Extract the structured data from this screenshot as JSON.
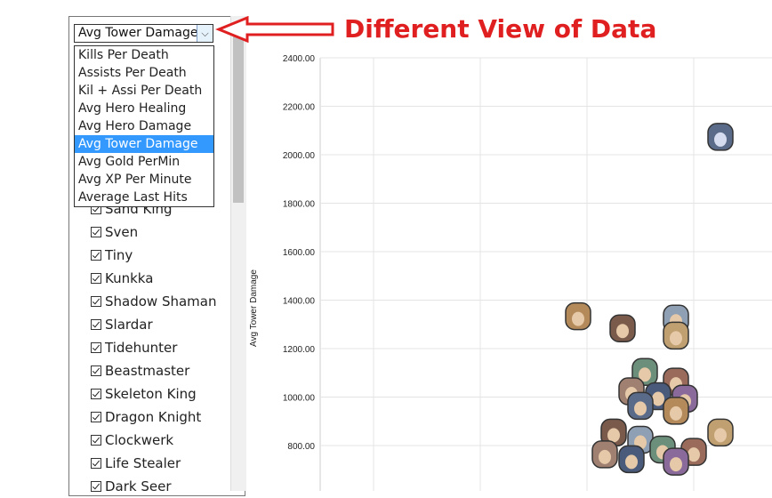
{
  "dropdown": {
    "selected": "Avg Tower Damage",
    "options": [
      "Kills Per Death",
      "Assists Per Death",
      "Kil + Assi Per Death",
      "Avg Hero Healing",
      "Avg Hero Damage",
      "Avg Tower Damage",
      "Avg Gold PerMin",
      "Avg XP Per Minute",
      "Average Last Hits"
    ],
    "selected_index": 5
  },
  "heroes": [
    "Sand King",
    "Sven",
    "Tiny",
    "Kunkka",
    "Shadow Shaman",
    "Slardar",
    "Tidehunter",
    "Beastmaster",
    "Skeleton King",
    "Dragon Knight",
    "Clockwerk",
    "Life Stealer",
    "Dark Seer"
  ],
  "annotation": {
    "text": "Different View of Data",
    "color": "#e02020"
  },
  "chart_data": {
    "type": "scatter",
    "ylabel": "Avg Tower Damage",
    "yticks": [
      "2400.00",
      "2200.00",
      "2000.00",
      "1800.00",
      "1600.00",
      "1400.00",
      "1200.00",
      "1000.00",
      "800.00"
    ],
    "ylim": [
      700,
      2400
    ],
    "grid": true,
    "points": [
      {
        "x": 810,
        "y": 2070
      },
      {
        "x": 650,
        "y": 1330
      },
      {
        "x": 700,
        "y": 1280
      },
      {
        "x": 760,
        "y": 1320
      },
      {
        "x": 760,
        "y": 1250
      },
      {
        "x": 725,
        "y": 1100
      },
      {
        "x": 760,
        "y": 1060
      },
      {
        "x": 710,
        "y": 1020
      },
      {
        "x": 740,
        "y": 1000
      },
      {
        "x": 770,
        "y": 990
      },
      {
        "x": 720,
        "y": 960
      },
      {
        "x": 760,
        "y": 940
      },
      {
        "x": 690,
        "y": 850
      },
      {
        "x": 720,
        "y": 820
      },
      {
        "x": 810,
        "y": 850
      },
      {
        "x": 745,
        "y": 780
      },
      {
        "x": 780,
        "y": 770
      },
      {
        "x": 680,
        "y": 760
      },
      {
        "x": 710,
        "y": 740
      },
      {
        "x": 760,
        "y": 730
      }
    ]
  }
}
